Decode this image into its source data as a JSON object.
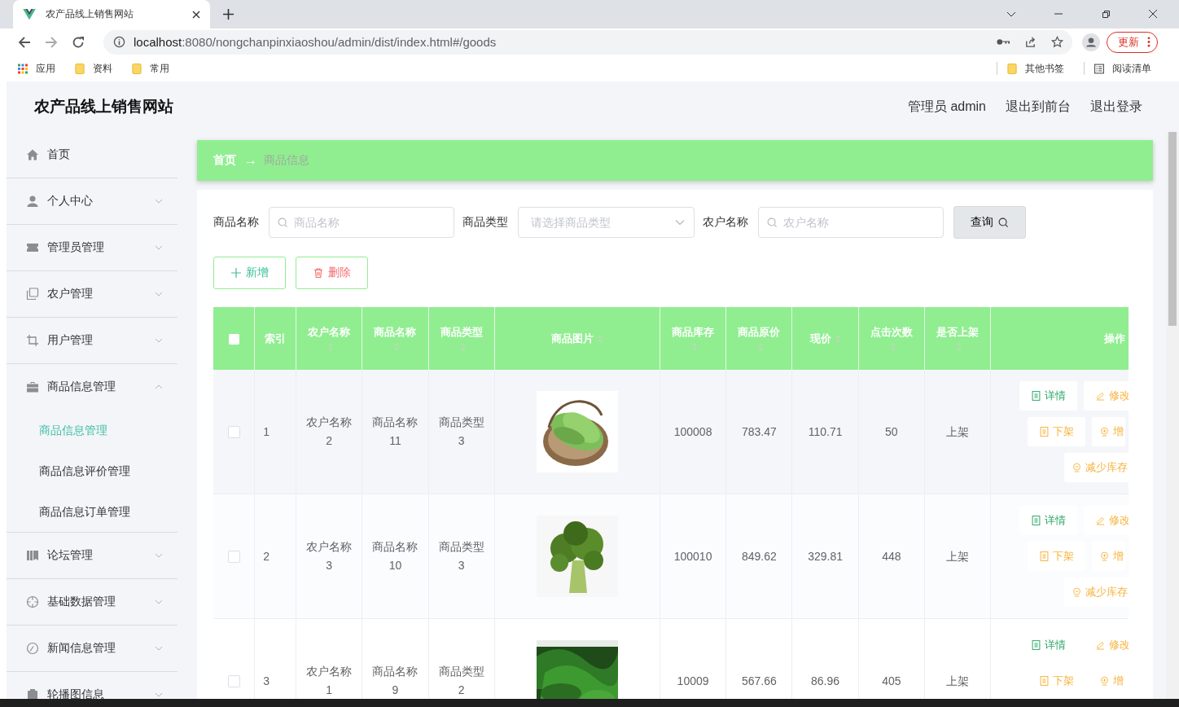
{
  "browser": {
    "tab_title": "农产品线上销售网站",
    "url_host": "localhost",
    "url_rest": ":8080/nongchanpinxiaoshou/admin/dist/index.html#/goods",
    "update_button": "更新",
    "bookmarks": [
      {
        "label": "应用",
        "kind": "apps"
      },
      {
        "label": "资料",
        "kind": "folder"
      },
      {
        "label": "常用",
        "kind": "folder"
      }
    ],
    "bookmarks_right": [
      {
        "label": "其他书签",
        "kind": "folder"
      },
      {
        "label": "阅读清单",
        "kind": "list"
      }
    ]
  },
  "header": {
    "title": "农产品线上销售网站",
    "user": "管理员 admin",
    "links": [
      "退出到前台",
      "退出登录"
    ]
  },
  "sidebar": {
    "items": [
      {
        "label": "首页",
        "expandable": false
      },
      {
        "label": "个人中心",
        "expandable": true,
        "expanded": false
      },
      {
        "label": "管理员管理",
        "expandable": true,
        "expanded": false
      },
      {
        "label": "农户管理",
        "expandable": true,
        "expanded": false
      },
      {
        "label": "用户管理",
        "expandable": true,
        "expanded": false
      },
      {
        "label": "商品信息管理",
        "expandable": true,
        "expanded": true,
        "children": [
          {
            "label": "商品信息管理",
            "selected": true
          },
          {
            "label": "商品信息评价管理",
            "selected": false
          },
          {
            "label": "商品信息订单管理",
            "selected": false
          }
        ]
      },
      {
        "label": "论坛管理",
        "expandable": true,
        "expanded": false
      },
      {
        "label": "基础数据管理",
        "expandable": true,
        "expanded": false
      },
      {
        "label": "新闻信息管理",
        "expandable": true,
        "expanded": false
      },
      {
        "label": "轮播图信息",
        "expandable": true,
        "expanded": false
      }
    ]
  },
  "breadcrumb": {
    "home": "首页",
    "separator": "→",
    "current": "商品信息"
  },
  "search": {
    "fields": [
      {
        "label": "商品名称",
        "kind": "input",
        "placeholder": "商品名称"
      },
      {
        "label": "商品类型",
        "kind": "select",
        "placeholder": "请选择商品类型"
      },
      {
        "label": "农户名称",
        "kind": "input",
        "placeholder": "农户名称"
      }
    ],
    "query_button": "查询"
  },
  "actions": [
    {
      "label": "新增",
      "kind": "add"
    },
    {
      "label": "删除",
      "kind": "delete"
    }
  ],
  "table": {
    "all_checked": false,
    "columns": [
      {
        "label": "索引",
        "sortable": false
      },
      {
        "label": "农户名称",
        "sortable": true
      },
      {
        "label": "商品名称",
        "sortable": true
      },
      {
        "label": "商品类型",
        "sortable": true
      },
      {
        "label": "商品图片",
        "sortable": true
      },
      {
        "label": "商品库存",
        "sortable": true
      },
      {
        "label": "商品原价",
        "sortable": true
      },
      {
        "label": "现价",
        "sortable": true
      },
      {
        "label": "点击次数",
        "sortable": true
      },
      {
        "label": "是否上架",
        "sortable": true
      },
      {
        "label": "操作",
        "sortable": false
      }
    ],
    "rows": [
      {
        "checked": false,
        "cells": [
          "1",
          "农户名称2",
          "商品名称11",
          "商品类型3"
        ],
        "picture": {
          "kind": "picture"
        },
        "cells2": [
          "100008",
          "783.47",
          "110.71",
          "50",
          "上架"
        ],
        "ops": [
          [
            {
              "label": "详情",
              "kind": "detail"
            },
            {
              "label": "修改",
              "kind": "edit"
            }
          ],
          [
            {
              "label": "下架",
              "kind": "off"
            },
            {
              "label": "增",
              "kind": "add-stock"
            }
          ],
          [
            {
              "label": "减少库存",
              "kind": "reduce-stock"
            }
          ]
        ]
      },
      {
        "checked": false,
        "cells": [
          "2",
          "农户名称3",
          "商品名称10",
          "商品类型3"
        ],
        "picture": {
          "kind": "picture"
        },
        "cells2": [
          "100010",
          "849.62",
          "329.81",
          "448",
          "上架"
        ],
        "ops": [
          [
            {
              "label": "详情",
              "kind": "detail"
            },
            {
              "label": "修改",
              "kind": "edit"
            }
          ],
          [
            {
              "label": "下架",
              "kind": "off"
            },
            {
              "label": "增",
              "kind": "add-stock"
            }
          ],
          [
            {
              "label": "减少库存",
              "kind": "reduce-stock"
            }
          ]
        ]
      },
      {
        "checked": false,
        "cells": [
          "3",
          "农户名称1",
          "商品名称9",
          "商品类型2"
        ],
        "picture": {
          "kind": "picture"
        },
        "cells2": [
          "10009",
          "567.66",
          "86.96",
          "405",
          "上架"
        ],
        "ops": [
          [
            {
              "label": "详情",
              "kind": "detail"
            },
            {
              "label": "修改",
              "kind": "edit"
            }
          ],
          [
            {
              "label": "下架",
              "kind": "off"
            },
            {
              "label": "增",
              "kind": "add-stock"
            }
          ]
        ]
      }
    ]
  }
}
